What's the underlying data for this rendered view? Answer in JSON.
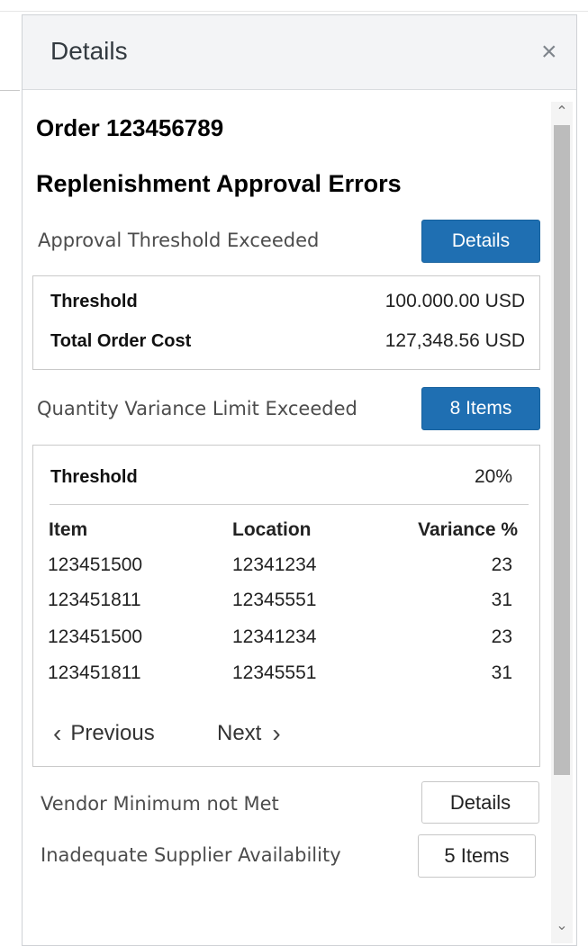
{
  "panel": {
    "title": "Details",
    "close_icon": "close-icon"
  },
  "order": {
    "title": "Order 123456789"
  },
  "section_title": "Replenishment Approval Errors",
  "approval_threshold": {
    "label": "Approval Threshold Exceeded",
    "button": "Details",
    "rows": [
      {
        "key": "Threshold",
        "value": "100.000.00  USD"
      },
      {
        "key": "Total Order Cost",
        "value": "127,348.56  USD"
      }
    ]
  },
  "quantity_variance": {
    "label": "Quantity Variance Limit Exceeded",
    "button": "8 Items",
    "threshold_label": "Threshold",
    "threshold_value": "20%",
    "columns": [
      "Item",
      "Location",
      "Variance %"
    ],
    "rows": [
      [
        "123451500",
        "12341234",
        "23"
      ],
      [
        "123451811",
        "12345551",
        "31"
      ],
      [
        "123451500",
        "12341234",
        "23"
      ],
      [
        "123451811",
        "12345551",
        "31"
      ]
    ],
    "pager": {
      "previous": "Previous",
      "next": "Next"
    }
  },
  "vendor_minimum": {
    "label": "Vendor Minimum not Met",
    "button": "Details"
  },
  "supplier_availability": {
    "label": "Inadequate Supplier Availability",
    "button": "5 Items"
  },
  "scrollbar": {
    "up_icon": "chevron-up-icon",
    "down_icon": "chevron-down-icon"
  },
  "colors": {
    "primary_button": "#1f6fb2",
    "header_bg": "#f3f4f6",
    "scroll_thumb": "#bcbcbc"
  }
}
